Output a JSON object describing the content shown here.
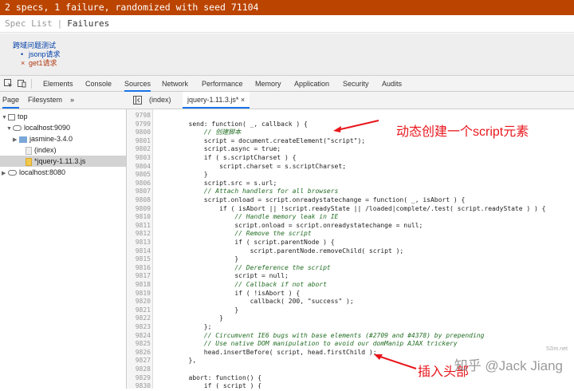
{
  "jasmine": {
    "status": "2 specs, 1 failure, randomized with seed 71104",
    "spec_list": "Spec List",
    "separator": "|",
    "failures": "Failures",
    "suite_title": "跨域问题测试",
    "specs": [
      {
        "mark": "•",
        "label": "jsonp请求"
      },
      {
        "mark": "×",
        "label": "get1请求"
      }
    ]
  },
  "devtools": {
    "tabs": [
      "Elements",
      "Console",
      "Sources",
      "Network",
      "Performance",
      "Memory",
      "Application",
      "Security",
      "Audits"
    ],
    "active_tab": "Sources",
    "navigator": {
      "tabs": [
        "Page",
        "Filesystem",
        "»"
      ],
      "tree": [
        {
          "label": "top"
        },
        {
          "label": "localhost:9090"
        },
        {
          "label": "jasmine-3.4.0"
        },
        {
          "label": "(index)"
        },
        {
          "label": "*jquery-1.11.3.js"
        },
        {
          "label": "localhost:8080"
        }
      ]
    },
    "editor": {
      "tabs": [
        "(index)",
        "jquery-1.11.3.js*"
      ],
      "close_glyph": "×"
    }
  },
  "code": {
    "line_numbers": [
      "9798",
      "9799",
      "9800",
      "9801",
      "9802",
      "9803",
      "9804",
      "9805",
      "9806",
      "9807",
      "9808",
      "9809",
      "9810",
      "9811",
      "9812",
      "9813",
      "9814",
      "9815",
      "9816",
      "9817",
      "9818",
      "9819",
      "9820",
      "9821",
      "9822",
      "9823",
      "9824",
      "9825",
      "9826",
      "9827",
      "9828",
      "9829",
      "9830"
    ],
    "lines": [
      "",
      "        send: function( _, callback ) {",
      "            // 创建脚本",
      "            script = document.createElement(\"script\");",
      "            script.async = true;",
      "            if ( s.scriptCharset ) {",
      "                script.charset = s.scriptCharset;",
      "            }",
      "            script.src = s.url;",
      "            // Attach handlers for all browsers",
      "            script.onload = script.onreadystatechange = function( _, isAbort ) {",
      "                if ( isAbort || !script.readyState || /loaded|complete/.test( script.readyState ) ) {",
      "                    // Handle memory leak in IE",
      "                    script.onload = script.onreadystatechange = null;",
      "                    // Remove the script",
      "                    if ( script.parentNode ) {",
      "                        script.parentNode.removeChild( script );",
      "                    }",
      "                    // Dereference the script",
      "                    script = null;",
      "                    // Callback if not abort",
      "                    if ( !isAbort ) {",
      "                        callback( 200, \"success\" );",
      "                    }",
      "                }",
      "            };",
      "            // Circumvent IE6 bugs with base elements (#2709 and #4378) by prepending",
      "            // Use native DOM manipulation to avoid our domManip AJAX trickery",
      "            head.insertBefore( script, head.firstChild );",
      "        },",
      "",
      "        abort: function() {",
      "            if ( script ) {"
    ]
  },
  "annotations": {
    "top": "动态创建一个script元素",
    "bottom": "插入头部"
  },
  "watermark": "知乎 @Jack Jiang",
  "watermark_small": "52im.net",
  "colors": {
    "jasmine_bar": "#bb4400",
    "annotation": "#e8161c",
    "active_tab_underline": "#1a73e8"
  }
}
